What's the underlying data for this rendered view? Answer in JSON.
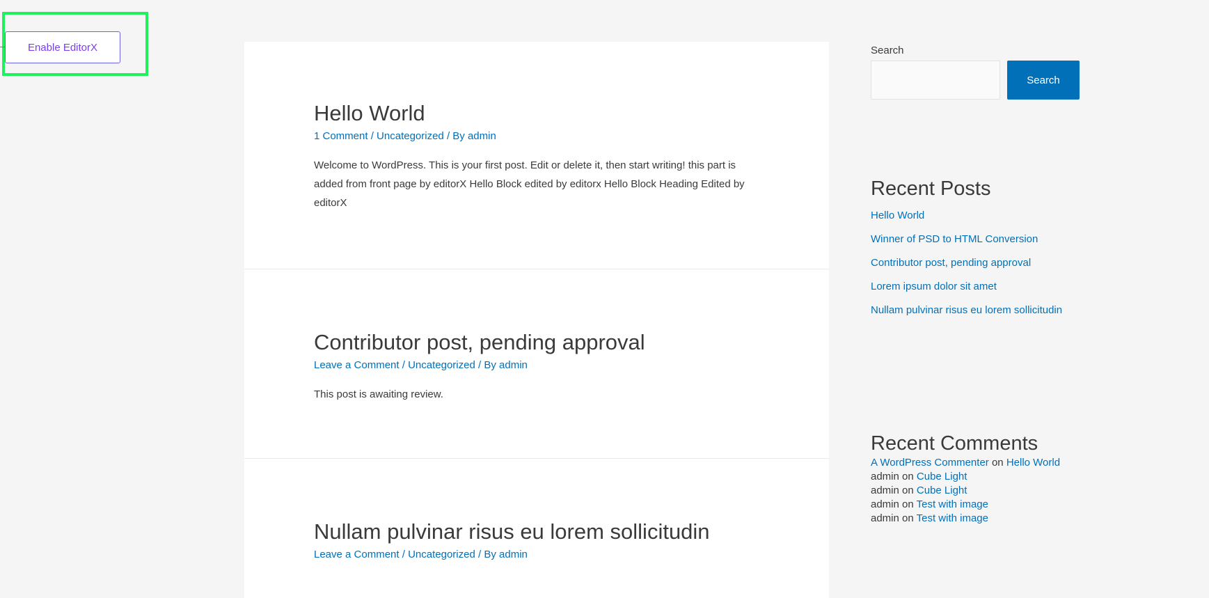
{
  "editorx": {
    "button_label": "Enable EditorX"
  },
  "posts": [
    {
      "title": "Hello World",
      "meta": {
        "comments": "1 Comment",
        "sep1": " / ",
        "category": "Uncategorized",
        "sep2": " / By ",
        "author": "admin"
      },
      "excerpt": "Welcome to WordPress. This is your first post. Edit or delete it, then start writing! this part is added from front page by editorX Hello Block edited by editorx Hello Block Heading Edited by editorX"
    },
    {
      "title": "Contributor post, pending approval",
      "meta": {
        "comments": "Leave a Comment",
        "sep1": " / ",
        "category": "Uncategorized",
        "sep2": " / By ",
        "author": "admin"
      },
      "excerpt": "This post is awaiting review."
    },
    {
      "title": "Nullam pulvinar risus eu lorem sollicitudin",
      "meta": {
        "comments": "Leave a Comment",
        "sep1": " / ",
        "category": "Uncategorized",
        "sep2": " / By ",
        "author": "admin"
      }
    }
  ],
  "sidebar": {
    "search": {
      "label": "Search",
      "value": "",
      "button_label": "Search"
    },
    "recent_posts": {
      "title": "Recent Posts",
      "items": [
        "Hello World",
        "Winner of PSD to HTML Conversion",
        "Contributor post, pending approval",
        "Lorem ipsum dolor sit amet",
        "Nullam pulvinar risus eu lorem sollicitudin"
      ]
    },
    "recent_comments": {
      "title": "Recent Comments",
      "on_word": " on ",
      "items": [
        {
          "author": "A WordPress Commenter",
          "post": "Hello World"
        },
        {
          "author": "admin",
          "post": "Cube Light"
        },
        {
          "author": "admin",
          "post": "Cube Light"
        },
        {
          "author": "admin",
          "post": "Test with image"
        },
        {
          "author": "admin",
          "post": "Test with image"
        }
      ]
    }
  },
  "colors": {
    "link": "#0170b9",
    "highlight": "#1ff15d",
    "editorx_text": "#7b3fe4",
    "background": "#f5f5f5"
  }
}
